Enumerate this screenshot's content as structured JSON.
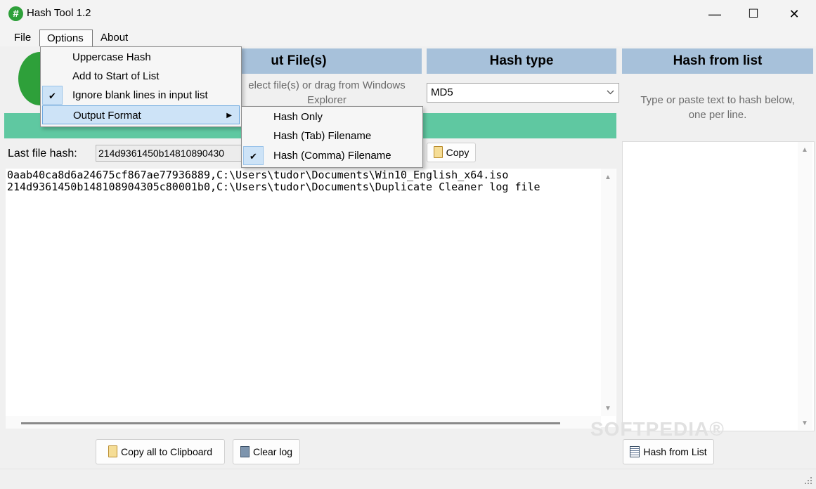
{
  "window": {
    "title": "Hash Tool 1.2",
    "app_icon": "#",
    "minimize": "—",
    "maximize": "☐",
    "close": "✕"
  },
  "menubar": {
    "file": "File",
    "options": "Options",
    "about": "About"
  },
  "options_menu": {
    "items": [
      {
        "label": "Uppercase Hash",
        "checked": false
      },
      {
        "label": "Add to Start of List",
        "checked": false
      },
      {
        "label": "Ignore blank lines in input list",
        "checked": true
      },
      {
        "label": "Output Format",
        "has_submenu": true,
        "highlighted": true
      }
    ]
  },
  "output_format_menu": {
    "items": [
      {
        "label": "Hash Only",
        "checked": false
      },
      {
        "label": "Hash (Tab) Filename",
        "checked": false
      },
      {
        "label": "Hash (Comma) Filename",
        "checked": true
      }
    ]
  },
  "input_panel": {
    "header": "ut File(s)",
    "hint_line1": "elect file(s) or drag from Windows",
    "hint_line2": "Explorer"
  },
  "hash_type": {
    "header": "Hash type",
    "selected": "MD5"
  },
  "last_hash": {
    "label": "Last file hash:",
    "value": "214d9361450b14810890430",
    "copy_label": "Copy"
  },
  "log": {
    "lines": [
      "0aab40ca8d6a24675cf867ae77936889,C:\\Users\\tudor\\Documents\\Win10_English_x64.iso",
      "214d9361450b148108904305c80001b0,C:\\Users\\tudor\\Documents\\Duplicate Cleaner log file"
    ]
  },
  "buttons": {
    "copy_all": "Copy all to Clipboard",
    "clear_log": "Clear log",
    "hash_from_list": "Hash from List"
  },
  "hash_list_panel": {
    "header": "Hash from list",
    "hint_line1": "Type or paste text to hash below,",
    "hint_line2": "one per line."
  },
  "watermark": "SOFTPEDIA®",
  "colors": {
    "header_bg": "#a7c1da",
    "progress_green": "#5fc8a1",
    "menu_highlight": "#cde3f7"
  }
}
